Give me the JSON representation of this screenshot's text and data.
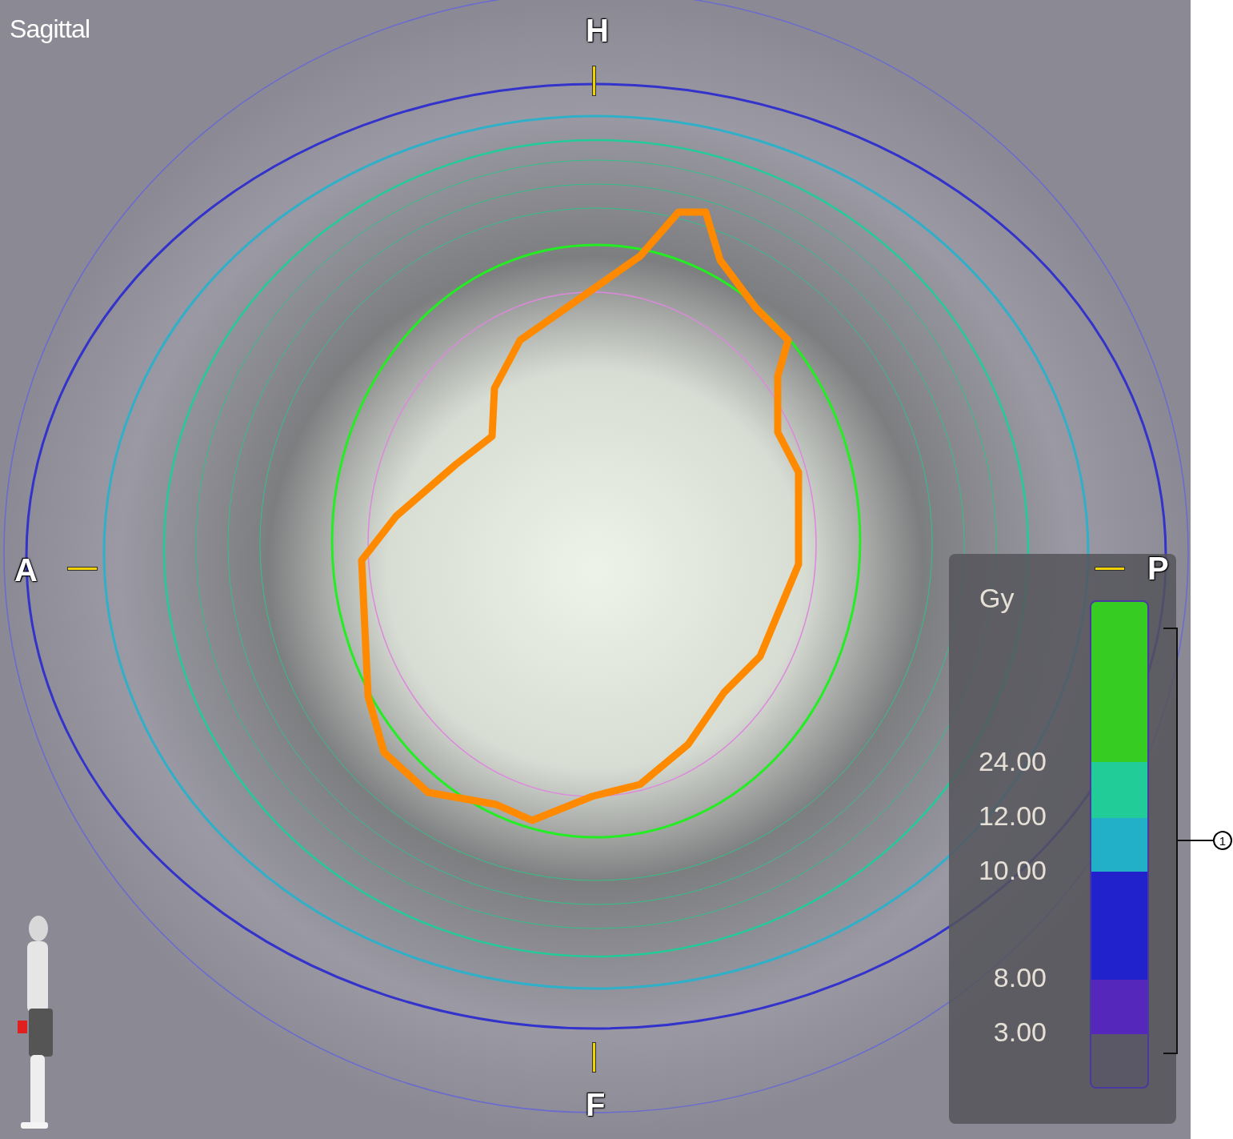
{
  "view": {
    "title": "Sagittal"
  },
  "orientation": [
    {
      "kind": "top",
      "label": "H"
    },
    {
      "kind": "left",
      "label": "A"
    },
    {
      "kind": "right",
      "label": "P"
    },
    {
      "kind": "bottom",
      "label": "F"
    }
  ],
  "legend": {
    "unit": "Gy",
    "ticks": [
      "24.00",
      "12.00",
      "10.00",
      "8.00",
      "3.00"
    ],
    "bands": [
      {
        "color": "#36cc22"
      },
      {
        "color": "#22cc99"
      },
      {
        "color": "#22b0c8"
      },
      {
        "color": "#2222cc"
      },
      {
        "color": "#5528bb"
      }
    ]
  },
  "callout": {
    "label": "1"
  }
}
